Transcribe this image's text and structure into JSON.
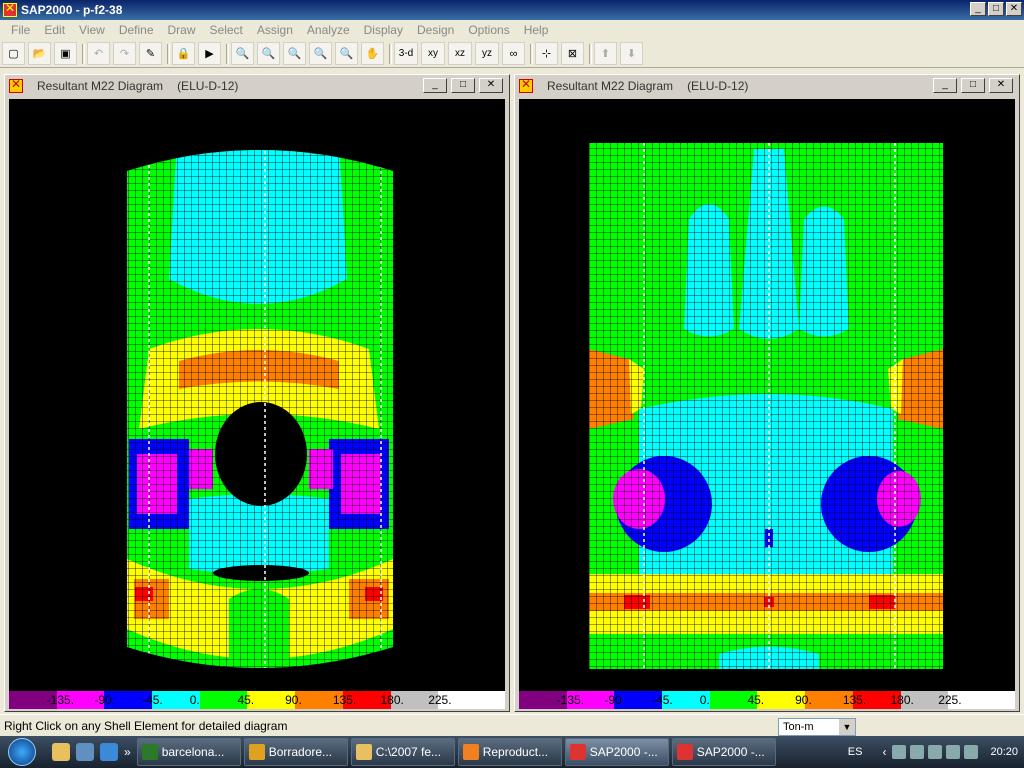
{
  "app": {
    "title": "SAP2000 - p-f2-38"
  },
  "window_controls": [
    "minimize",
    "maximize",
    "close"
  ],
  "menu": [
    "File",
    "Edit",
    "View",
    "Define",
    "Draw",
    "Select",
    "Assign",
    "Analyze",
    "Display",
    "Design",
    "Options",
    "Help"
  ],
  "toolbar": {
    "view_3d": "3-d",
    "view_xy": "xy",
    "view_xz": "xz",
    "view_yz": "yz"
  },
  "windows": [
    {
      "title": "Resultant M22 Diagram",
      "combo": "(ELU-D-12)"
    },
    {
      "title": "Resultant M22 Diagram",
      "combo": "(ELU-D-12)"
    }
  ],
  "legend": {
    "labels": [
      "-135.",
      "-90.",
      "-45.",
      "0.",
      "45.",
      "90.",
      "135.",
      "180.",
      "225."
    ],
    "colors": [
      "#800080",
      "#ff00ff",
      "#0000ff",
      "#00ffff",
      "#00ff00",
      "#ffff00",
      "#ff8000",
      "#ff0000",
      "#ffffff"
    ]
  },
  "status": {
    "message": "Right Click on any Shell Element for detailed diagram",
    "units": "Ton-m"
  },
  "taskbar": {
    "tasks": [
      "barcelona...",
      "Borradore...",
      "C:\\2007 fe...",
      "Reproduct...",
      "SAP2000 -...",
      "SAP2000 -..."
    ],
    "language": "ES",
    "time": "20:20"
  }
}
